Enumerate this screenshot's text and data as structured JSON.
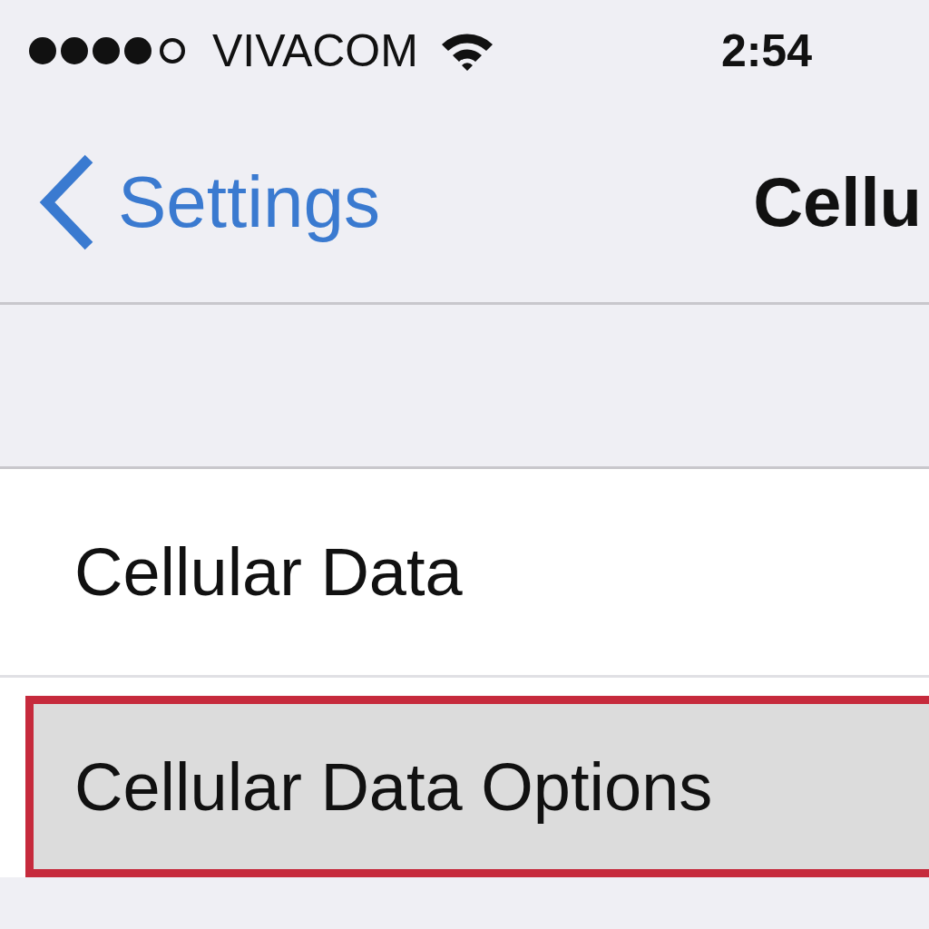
{
  "status_bar": {
    "carrier": "VIVACOM",
    "time": "2:54"
  },
  "nav_bar": {
    "back_label": "Settings",
    "title": "Cellu"
  },
  "rows": [
    {
      "label": "Cellular Data",
      "highlighted": false
    },
    {
      "label": "Cellular Data Options",
      "highlighted": true
    }
  ]
}
